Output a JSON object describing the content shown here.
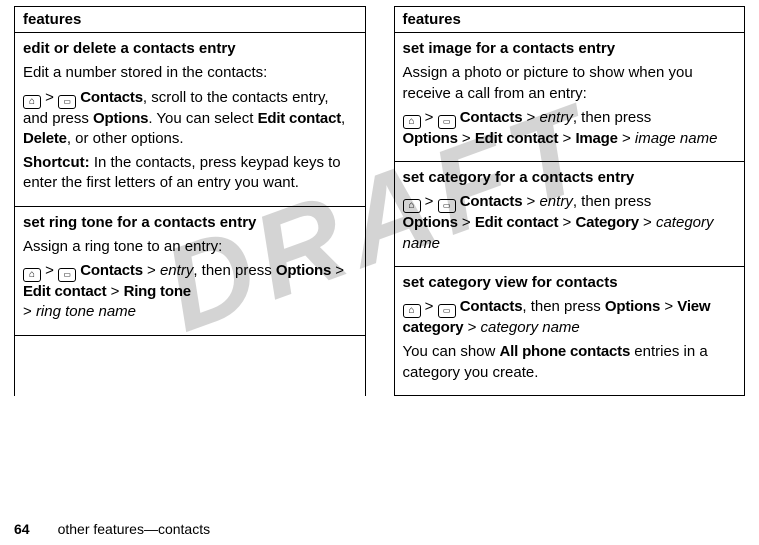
{
  "watermark": "DRAFT",
  "left": {
    "header": "features",
    "cells": [
      {
        "title": "edit or delete a contacts entry",
        "line1": "Edit a number stored in the contacts:",
        "nav1_pre": "",
        "nav1_contacts": "Contacts",
        "nav1_tail": ", scroll to the contacts entry, and press ",
        "options": "Options",
        "tail2": ". You can select ",
        "editcontact": "Edit contact",
        "comma": ", ",
        "delete": "Delete",
        "tail3": ", or other options.",
        "shortcut_label": "Shortcut:",
        "shortcut_text": " In the contacts, press keypad keys to enter the first letters of an entry you want."
      },
      {
        "title": "set ring tone for a contacts entry",
        "line1": "Assign a ring tone to an entry:",
        "contacts": "Contacts",
        "gt": " > ",
        "entry": "entry",
        "thenpress": ", then press ",
        "options": "Options",
        "editcontact": "Edit contact",
        "ringtone": "Ring tone",
        "ringtonename": "ring tone name"
      }
    ]
  },
  "right": {
    "header": "features",
    "cells": [
      {
        "title": "set image for a contacts entry",
        "line1": "Assign a photo or picture to show when you receive a call from an entry:",
        "contacts": "Contacts",
        "entry": "entry",
        "thenpress": ", then press ",
        "options": "Options",
        "editcontact": "Edit contact",
        "image": "Image",
        "imagename": "image name"
      },
      {
        "title": "set category for a contacts entry",
        "contacts": "Contacts",
        "entry": "entry",
        "thenpress": ", then press ",
        "options": "Options",
        "editcontact": "Edit contact",
        "category": "Category",
        "categoryname": "category name"
      },
      {
        "title": "set category view for contacts",
        "contacts": "Contacts",
        "thenpress": ", then press ",
        "options": "Options",
        "viewcategory": "View category",
        "categoryname": "category name",
        "tail_pre": "You can show ",
        "allphone": "All phone contacts",
        "tail_post": " entries in a category you create."
      }
    ]
  },
  "footer": {
    "page": "64",
    "section": "other features—contacts"
  }
}
